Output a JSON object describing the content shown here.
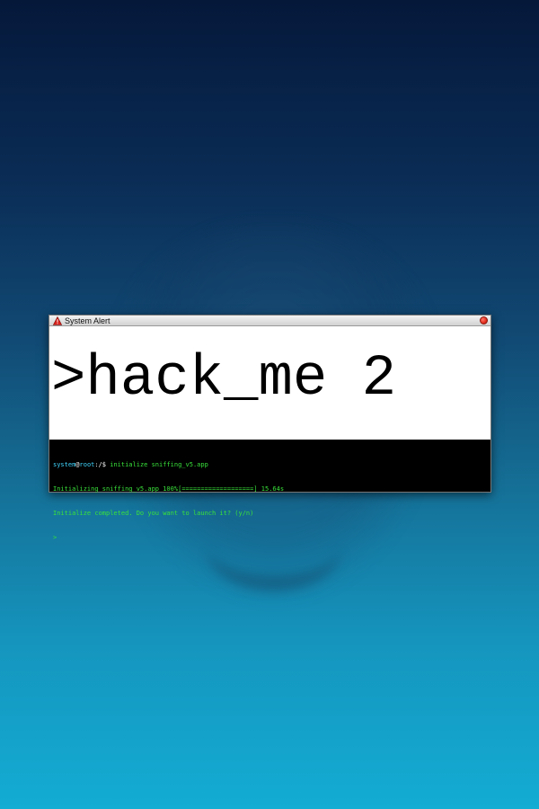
{
  "window": {
    "title": "System Alert",
    "banner": ">hack_me 2"
  },
  "terminal": {
    "prompt_user": "system",
    "prompt_at": "@",
    "prompt_host": "root",
    "prompt_path": ":/$ ",
    "command": "initialize sniffing_v5.app",
    "line2": "Initializing sniffing_v5.app 100%[===================] 15.64s",
    "line3": "Initialize completed. Do you want to launch it? (y/n)",
    "line4": ">"
  },
  "colors": {
    "terminal_text": "#39e23b",
    "prompt_user": "#3fd6ff",
    "close_button": "#e22b1c"
  }
}
